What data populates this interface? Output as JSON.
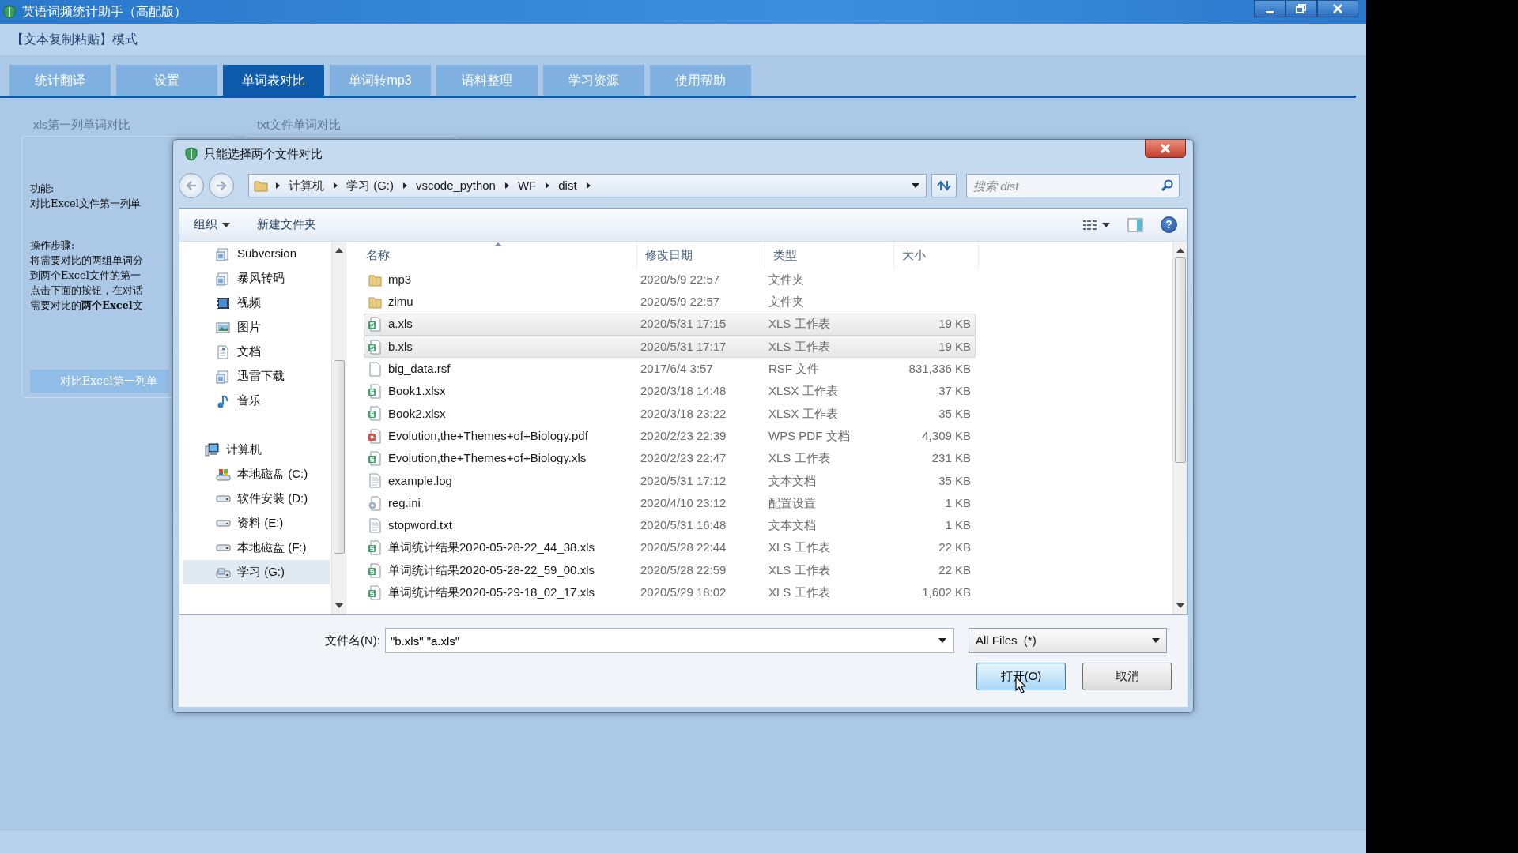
{
  "window": {
    "title": "英语词频统计助手（高配版）"
  },
  "mode_label": "【文本复制粘贴】模式",
  "tabs": [
    {
      "label": "统计翻译",
      "selected": false
    },
    {
      "label": "设置",
      "selected": false
    },
    {
      "label": "单词表对比",
      "selected": true
    },
    {
      "label": "单词转mp3",
      "selected": false
    },
    {
      "label": "语料整理",
      "selected": false
    },
    {
      "label": "学习资源",
      "selected": false
    },
    {
      "label": "使用帮助",
      "selected": false
    }
  ],
  "groups": [
    {
      "title": "xls第一列单词对比"
    },
    {
      "title": "txt文件单词对比"
    }
  ],
  "left_panel": {
    "paragraphs": [
      [
        "功能:",
        "对比Excel文件第一列单"
      ],
      [
        "操作步骤:",
        "将需要对比的两组单词分",
        "到两个Excel文件的第一",
        "点击下面的按钮，在对话",
        "需要对比的**两个Excel**文"
      ]
    ],
    "button": "对比Excel第一列单"
  },
  "dialog": {
    "title": "只能选择两个文件对比",
    "breadcrumb": [
      "计算机",
      "学习 (G:)",
      "vscode_python",
      "WF",
      "dist"
    ],
    "search": {
      "placeholder": "搜索 dist"
    },
    "toolbar": {
      "organize": "组织",
      "new_folder": "新建文件夹",
      "help": "?"
    },
    "nav": [
      {
        "label": "Subversion",
        "kind": "library",
        "selected": false
      },
      {
        "label": "暴风转码",
        "kind": "library",
        "selected": false
      },
      {
        "label": "视频",
        "kind": "video",
        "selected": false
      },
      {
        "label": "图片",
        "kind": "pictures",
        "selected": false
      },
      {
        "label": "文档",
        "kind": "documents",
        "selected": false
      },
      {
        "label": "迅雷下载",
        "kind": "library",
        "selected": false
      },
      {
        "label": "音乐",
        "kind": "music",
        "selected": false
      },
      {
        "label": "计算机",
        "kind": "computer",
        "selected": false,
        "children": [
          {
            "label": "本地磁盘 (C:)",
            "kind": "system-drive",
            "selected": false
          },
          {
            "label": "软件安装 (D:)",
            "kind": "drive",
            "selected": false
          },
          {
            "label": "资料 (E:)",
            "kind": "drive",
            "selected": false
          },
          {
            "label": "本地磁盘 (F:)",
            "kind": "drive",
            "selected": false
          },
          {
            "label": "学习 (G:)",
            "kind": "media-drive",
            "selected": true
          }
        ]
      }
    ],
    "columns": [
      "名称",
      "修改日期",
      "类型",
      "大小"
    ],
    "files": [
      {
        "name": "mp3",
        "modified": "2020/5/9 22:57",
        "type": "文件夹",
        "kind": "folder",
        "selected": false
      },
      {
        "name": "zimu",
        "modified": "2020/5/9 22:57",
        "type": "文件夹",
        "kind": "folder",
        "selected": false
      },
      {
        "name": "a.xls",
        "modified": "2020/5/31 17:15",
        "type": "XLS 工作表",
        "size": "19 KB",
        "kind": "sheet",
        "selected": true
      },
      {
        "name": "b.xls",
        "modified": "2020/5/31 17:17",
        "type": "XLS 工作表",
        "size": "19 KB",
        "kind": "sheet",
        "selected": true
      },
      {
        "name": "big_data.rsf",
        "modified": "2017/6/4 3:57",
        "type": "RSF 文件",
        "size": "831,336 KB",
        "kind": "blank",
        "selected": false
      },
      {
        "name": "Book1.xlsx",
        "modified": "2020/3/18 14:48",
        "type": "XLSX 工作表",
        "size": "37 KB",
        "kind": "sheet",
        "selected": false
      },
      {
        "name": "Book2.xlsx",
        "modified": "2020/3/18 23:22",
        "type": "XLSX 工作表",
        "size": "35 KB",
        "kind": "sheet",
        "selected": false
      },
      {
        "name": "Evolution,the+Themes+of+Biology.pdf",
        "modified": "2020/2/23 22:39",
        "type": "WPS PDF 文档",
        "size": "4,309 KB",
        "kind": "pdf",
        "selected": false
      },
      {
        "name": "Evolution,the+Themes+of+Biology.xls",
        "modified": "2020/2/23 22:47",
        "type": "XLS 工作表",
        "size": "231 KB",
        "kind": "sheet",
        "selected": false
      },
      {
        "name": "example.log",
        "modified": "2020/5/31 17:12",
        "type": "文本文档",
        "size": "35 KB",
        "kind": "text",
        "selected": false
      },
      {
        "name": "reg.ini",
        "modified": "2020/4/10 23:12",
        "type": "配置设置",
        "size": "1 KB",
        "kind": "config",
        "selected": false
      },
      {
        "name": "stopword.txt",
        "modified": "2020/5/31 16:48",
        "type": "文本文档",
        "size": "1 KB",
        "kind": "text",
        "selected": false
      },
      {
        "name": "单词统计结果2020-05-28-22_44_38.xls",
        "modified": "2020/5/28 22:44",
        "type": "XLS 工作表",
        "size": "22 KB",
        "kind": "sheet",
        "selected": false
      },
      {
        "name": "单词统计结果2020-05-28-22_59_00.xls",
        "modified": "2020/5/28 22:59",
        "type": "XLS 工作表",
        "size": "22 KB",
        "kind": "sheet",
        "selected": false
      },
      {
        "name": "单词统计结果2020-05-29-18_02_17.xls",
        "modified": "2020/5/29 18:02",
        "type": "XLS 工作表",
        "size": "1,602 KB",
        "kind": "sheet",
        "selected": false
      }
    ],
    "filename_label": "文件名(N):",
    "filename": "\"b.xls\" \"a.xls\"",
    "filter": "All Files  (*)",
    "buttons": [
      {
        "label": "打开(O)",
        "default": true
      },
      {
        "label": "取消",
        "default": false
      }
    ]
  }
}
